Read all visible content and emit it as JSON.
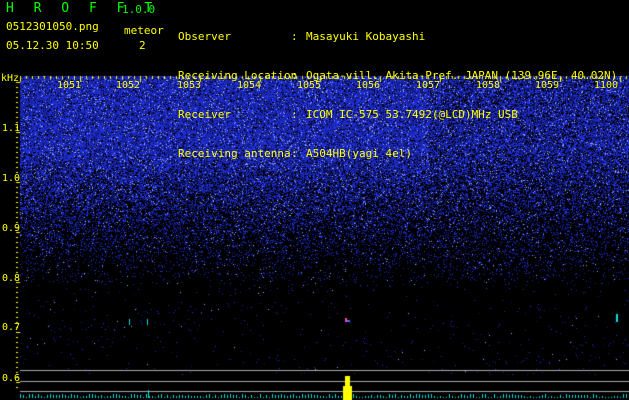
{
  "header": {
    "app_title": "H R O F F T",
    "version": "1.0.0",
    "filename": "0512301050.png",
    "datetime": "05.12.30 10:50",
    "meteor_label": "meteor",
    "meteor_count": "2"
  },
  "info": [
    {
      "key": "Observer",
      "sep": ":",
      "value": "Masayuki Kobayashi"
    },
    {
      "key": "Receiving Location",
      "sep": ":",
      "value": "Ogata-vill. Akita-Pref. JAPAN (139.96E, 40.02N)"
    },
    {
      "key": "Receiver",
      "sep": ":",
      "value": "ICOM IC-575 53.7492(@LCD)MHz USB"
    },
    {
      "key": "Receiving antenna",
      "sep": ":",
      "value": "A504HB(yagi 4el)"
    }
  ],
  "axes": {
    "y_unit": "kHz",
    "y_ticks": [
      "1.1",
      "1.0",
      "0.9",
      "0.8",
      "0.7",
      "0.6"
    ],
    "x_ticks": [
      "1051",
      "1052",
      "1053",
      "1054",
      "1055",
      "1056",
      "1057",
      "1058",
      "1059",
      "1100"
    ]
  },
  "colors": {
    "label": "#ffff00",
    "title": "#00ff00",
    "noise": "#2a3ccf",
    "trace": "#00e0e0",
    "echo": "#ffff00",
    "grid_line": "#aaaaaa"
  }
}
